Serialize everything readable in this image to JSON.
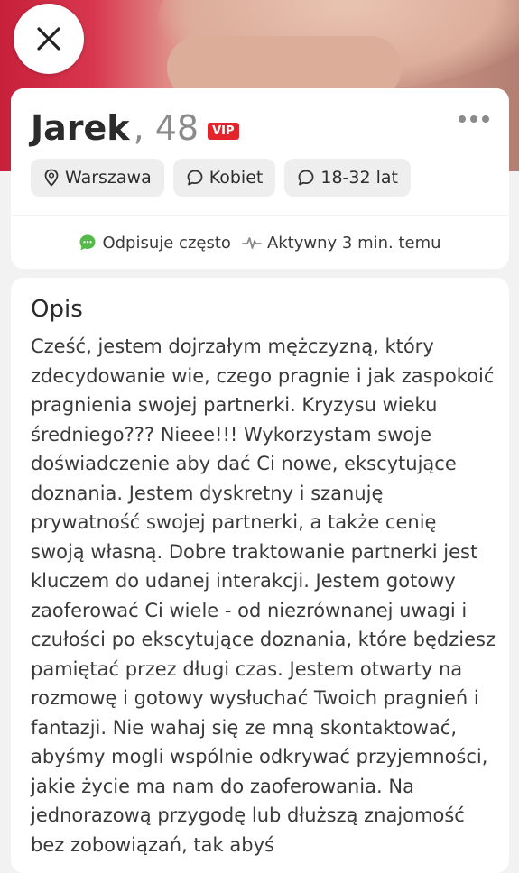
{
  "profile": {
    "name": "Jarek",
    "age": ", 48",
    "badge": "VIP",
    "chips": [
      {
        "icon": "location-pin-icon",
        "label": "Warszawa"
      },
      {
        "icon": "chat-bubble-icon",
        "label": "Kobiet"
      },
      {
        "icon": "chat-bubble-icon",
        "label": "18-32 lat"
      }
    ]
  },
  "status": {
    "reply_label": "Odpisuje często",
    "activity_label": "Aktywny 3 min. temu"
  },
  "description": {
    "title": "Opis",
    "text": "Cześć, jestem dojrzałym mężczyzną, który zdecydowanie wie, czego pragnie i jak zaspokoić pragnienia swojej partnerki. Kryzysu wieku średniego??? Nieee!!! Wykorzystam swoje doświadczenie aby dać Ci nowe, ekscytujące doznania. Jestem dyskretny i szanuję prywatność swojej partnerki, a także cenię swoją własną. Dobre traktowanie partnerki jest kluczem do udanej interakcji. Jestem gotowy zaoferować Ci wiele - od niezrównanej uwagi i czułości po ekscytujące doznania, które będziesz pamiętać przez długi czas. Jestem otwarty na rozmowę i gotowy wysłuchać Twoich pragnień i fantazji. Nie wahaj się ze mną skontaktować, abyśmy mogli wspólnie odkrywać przyjemności, jakie życie ma nam do zaoferowania. Na jednorazową przygodę lub dłuższą znajomość bez zobowiązań, tak abyś"
  },
  "colors": {
    "vip": "#e3242b",
    "reply_icon": "#54b948",
    "photo_red": "#c7203a"
  }
}
